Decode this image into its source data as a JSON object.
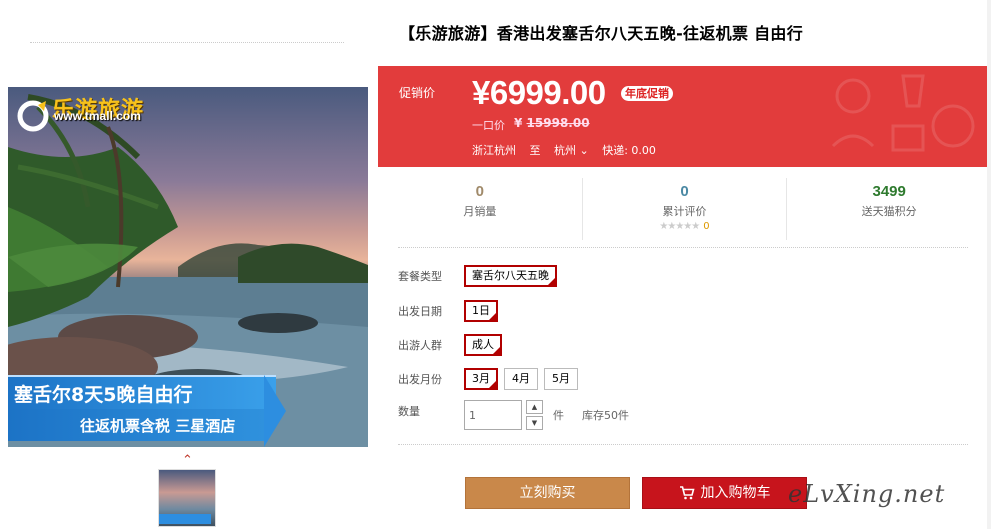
{
  "gallery": {
    "logo_text": "乐游旅游",
    "logo_url": "www.tmall.com",
    "banner_line1": "塞舌尔8天5晚自由行",
    "banner_line2": "往返机票含税 三星酒店",
    "prev_arrow": "⌃",
    "thumbnail_count": 1
  },
  "product": {
    "title": "【乐游旅游】香港出发塞舌尔八天五晚-往返机票 自由行"
  },
  "price": {
    "promo_label": "促销价",
    "current": "¥6999.00",
    "badge": "年底促销",
    "orig_label": "一口价",
    "orig_currency": "¥",
    "orig_value": "15998.00",
    "from": "浙江杭州",
    "to_word": "至",
    "dest": "杭州",
    "shipping": "快递: 0.00"
  },
  "stats": [
    {
      "value": "0",
      "label": "月销量"
    },
    {
      "value": "0",
      "label": "累计评价",
      "stars": "★★★★★",
      "star_count": "0"
    },
    {
      "value": "3499",
      "label": "送天猫积分"
    }
  ],
  "options": {
    "package": {
      "label": "套餐类型",
      "items": [
        "塞舌尔八天五晚"
      ],
      "selected": 0
    },
    "date": {
      "label": "出发日期",
      "items": [
        "1日"
      ],
      "selected": 0
    },
    "people": {
      "label": "出游人群",
      "items": [
        "成人"
      ],
      "selected": 0
    },
    "month": {
      "label": "出发月份",
      "items": [
        "3月",
        "4月",
        "5月"
      ],
      "selected": 0
    },
    "quantity": {
      "label": "数量",
      "value": "1",
      "unit": "件",
      "stock": "库存50件",
      "up": "▲",
      "down": "▼"
    }
  },
  "actions": {
    "buy_now": "立刻购买",
    "add_cart": "加入购物车"
  },
  "watermark": "eLvXing.net",
  "colors": {
    "price_bg": "#e23c3c",
    "selected_border": "#b10000",
    "buy_button": "#c9884a",
    "cart_button": "#c7141c"
  }
}
